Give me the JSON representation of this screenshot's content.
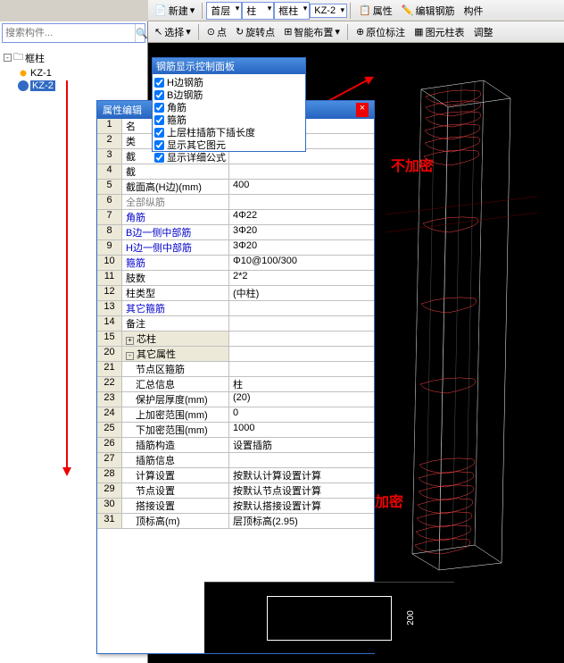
{
  "top1": {
    "new": "新建",
    "floor": "首层",
    "col": "柱",
    "kz": "框柱",
    "kz2": "KZ-2",
    "attr": "属性",
    "edit": "编辑钢筋",
    "comp": "构件"
  },
  "top2": {
    "sel": "选择",
    "pt": "点",
    "rot": "旋转点",
    "smart": "智能布置",
    "orig": "原位标注",
    "tbl": "图元柱表",
    "adj": "调整"
  },
  "search": {
    "ph": "搜索构件..."
  },
  "tree": {
    "root": "框柱",
    "k1": "KZ-1",
    "k2": "KZ-2"
  },
  "steelPanel": {
    "title": "钢筋显示控制面板",
    "items": [
      "H边钢筋",
      "B边钢筋",
      "角筋",
      "箍筋",
      "上层柱插筋下插长度",
      "显示其它图元",
      "显示详细公式"
    ]
  },
  "prop": {
    "title": "属性编辑",
    "rows": [
      {
        "n": "1",
        "l": "名",
        "v": ""
      },
      {
        "n": "2",
        "l": "类",
        "v": ""
      },
      {
        "n": "3",
        "l": "截",
        "v": ""
      },
      {
        "n": "4",
        "l": "截",
        "v": ""
      },
      {
        "n": "5",
        "l": "截面高(H边)(mm)",
        "v": "400"
      },
      {
        "n": "6",
        "l": "全部纵筋",
        "v": "",
        "gray": 1
      },
      {
        "n": "7",
        "l": "角筋",
        "v": "4Φ22",
        "blue": 1
      },
      {
        "n": "8",
        "l": "B边一侧中部筋",
        "v": "3Φ20",
        "blue": 1
      },
      {
        "n": "9",
        "l": "H边一侧中部筋",
        "v": "3Φ20",
        "blue": 1
      },
      {
        "n": "10",
        "l": "箍筋",
        "v": "Φ10@100/300",
        "blue": 1
      },
      {
        "n": "11",
        "l": "肢数",
        "v": "2*2"
      },
      {
        "n": "12",
        "l": "柱类型",
        "v": "(中柱)"
      },
      {
        "n": "13",
        "l": "其它箍筋",
        "v": "",
        "blue": 1
      },
      {
        "n": "14",
        "l": "备注",
        "v": ""
      },
      {
        "n": "15",
        "l": "芯柱",
        "v": "",
        "grp": 1,
        "pre": "+"
      },
      {
        "n": "20",
        "l": "其它属性",
        "v": "",
        "grp": 1,
        "pre": "-"
      },
      {
        "n": "21",
        "l": "　节点区箍筋",
        "v": ""
      },
      {
        "n": "22",
        "l": "　汇总信息",
        "v": "柱"
      },
      {
        "n": "23",
        "l": "　保护层厚度(mm)",
        "v": "(20)"
      },
      {
        "n": "24",
        "l": "　上加密范围(mm)",
        "v": "0"
      },
      {
        "n": "25",
        "l": "　下加密范围(mm)",
        "v": "1000"
      },
      {
        "n": "26",
        "l": "　插筋构造",
        "v": "设置插筋"
      },
      {
        "n": "27",
        "l": "　插筋信息",
        "v": ""
      },
      {
        "n": "28",
        "l": "　计算设置",
        "v": "按默认计算设置计算"
      },
      {
        "n": "29",
        "l": "　节点设置",
        "v": "按默认节点设置计算"
      },
      {
        "n": "30",
        "l": "　搭接设置",
        "v": "按默认搭接设置计算"
      },
      {
        "n": "31",
        "l": "　顶标高(m)",
        "v": "层顶标高(2.95)"
      }
    ]
  },
  "anno": {
    "no": "不加密",
    "yes": "加密"
  },
  "preview": {
    "dim": "200"
  }
}
